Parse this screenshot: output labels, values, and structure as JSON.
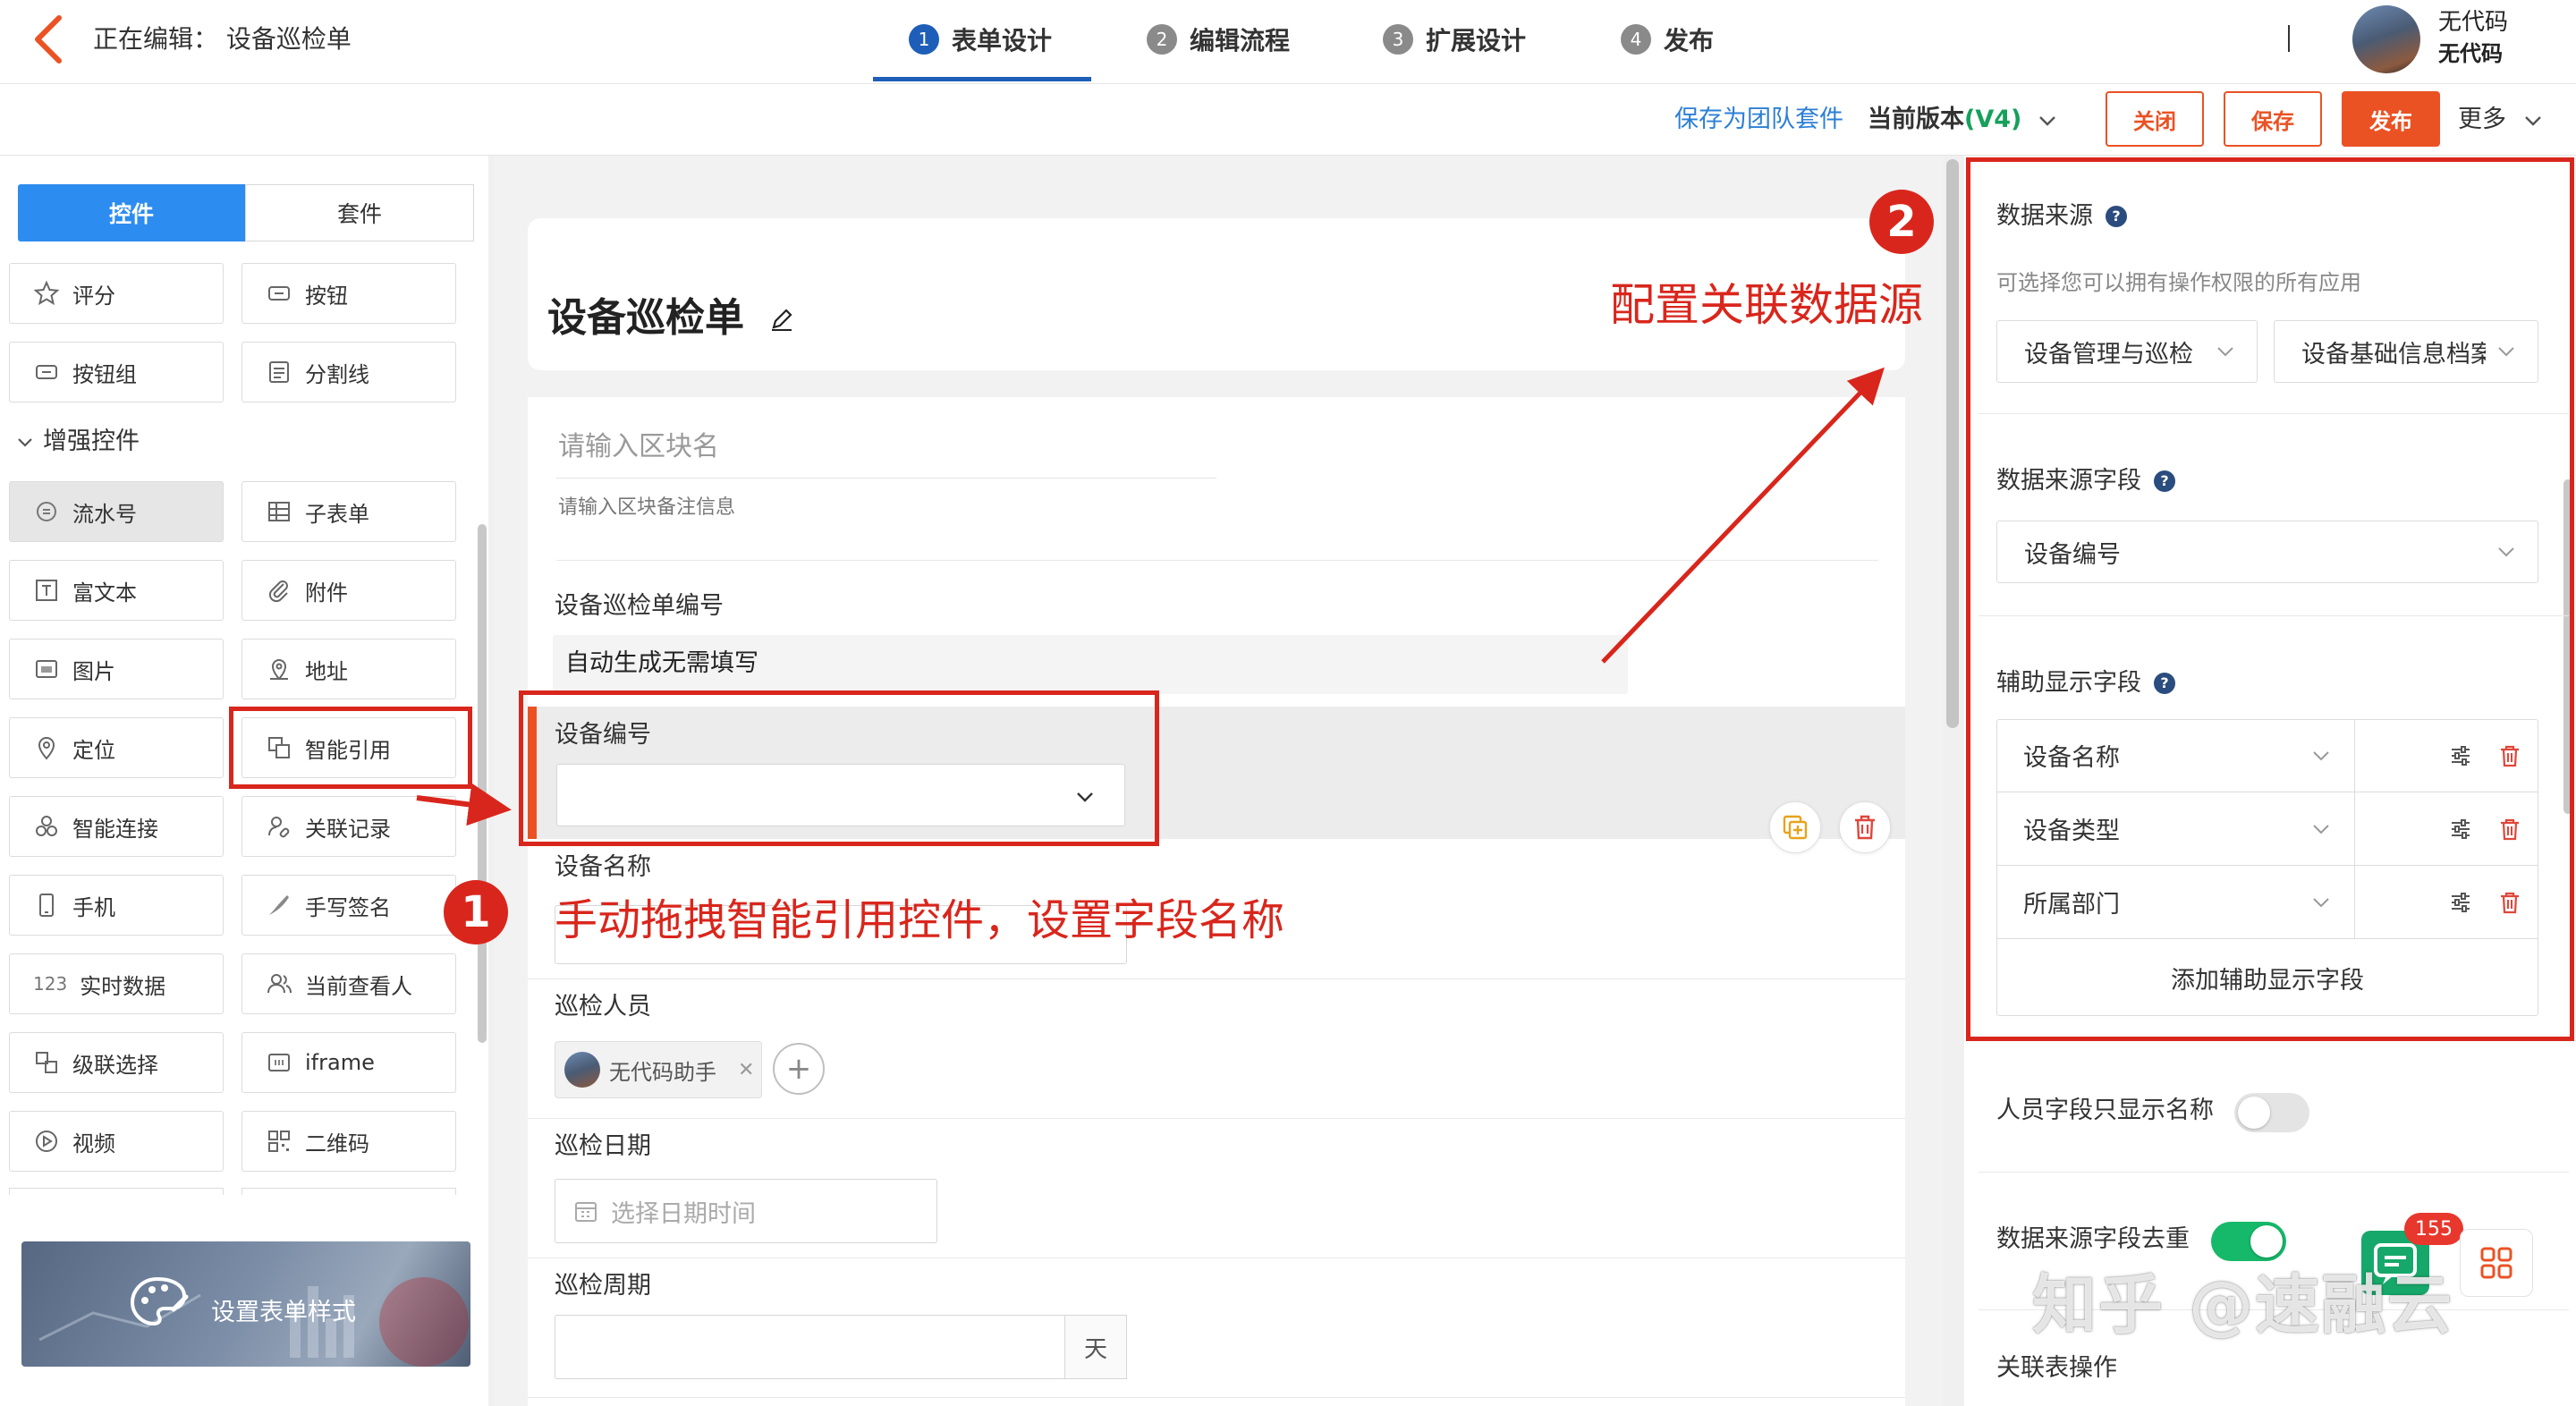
{
  "header": {
    "editing_label": "正在编辑：  设备巡检单",
    "steps": [
      {
        "num": "1",
        "label": "表单设计"
      },
      {
        "num": "2",
        "label": "编辑流程"
      },
      {
        "num": "3",
        "label": "扩展设计"
      },
      {
        "num": "4",
        "label": "发布"
      }
    ],
    "user_name": "无代码",
    "user_org": "无代码"
  },
  "actions": {
    "save_suite": "保存为团队套件",
    "version_prefix": "当前版本",
    "version_value": "(V4)",
    "close": "关闭",
    "save": "保存",
    "publish": "发布",
    "more": "更多"
  },
  "left": {
    "tab_controls": "控件",
    "tab_suites": "套件",
    "basic_controls": [
      {
        "icon": "star-icon",
        "label": "评分"
      },
      {
        "icon": "button-icon",
        "label": "按钮"
      },
      {
        "icon": "button-group-icon",
        "label": "按钮组"
      },
      {
        "icon": "divider-icon",
        "label": "分割线"
      }
    ],
    "enhanced_heading": "增强控件",
    "enhanced_controls": [
      {
        "icon": "serial-number-icon",
        "label": "流水号"
      },
      {
        "icon": "subform-icon",
        "label": "子表单"
      },
      {
        "icon": "rich-text-icon",
        "label": "富文本"
      },
      {
        "icon": "attachment-icon",
        "label": "附件"
      },
      {
        "icon": "image-icon",
        "label": "图片"
      },
      {
        "icon": "address-icon",
        "label": "地址"
      },
      {
        "icon": "location-icon",
        "label": "定位"
      },
      {
        "icon": "smart-reference-icon",
        "label": "智能引用"
      },
      {
        "icon": "smart-connect-icon",
        "label": "智能连接"
      },
      {
        "icon": "related-records-icon",
        "label": "关联记录"
      },
      {
        "icon": "phone-icon",
        "label": "手机"
      },
      {
        "icon": "signature-icon",
        "label": "手写签名"
      },
      {
        "icon": "realtime-data-icon",
        "label": "实时数据"
      },
      {
        "icon": "current-viewer-icon",
        "label": "当前查看人"
      },
      {
        "icon": "cascade-icon",
        "label": "级联选择"
      },
      {
        "icon": "iframe-icon",
        "label": "iframe"
      },
      {
        "icon": "video-icon",
        "label": "视频"
      },
      {
        "icon": "qrcode-icon",
        "label": "二维码"
      }
    ],
    "style_banner": "设置表单样式"
  },
  "form": {
    "title": "设备巡检单",
    "block_name_placeholder": "请输入区块名",
    "block_note_placeholder": "请输入区块备注信息",
    "field_inspection_no_label": "设备巡检单编号",
    "field_inspection_no_value": "自动生成无需填写",
    "field_device_no_label": "设备编号",
    "field_device_name_label": "设备名称",
    "field_inspector_label": "巡检人员",
    "inspector_chip": "无代码助手",
    "field_date_label": "巡检日期",
    "date_placeholder": "选择日期时间",
    "field_period_label": "巡检周期",
    "period_unit": "天"
  },
  "annotations": {
    "badge_1": "1",
    "badge_2": "2",
    "text_1": "手动拖拽智能引用控件，设置字段名称",
    "text_2": "配置关联数据源"
  },
  "right": {
    "data_source_label": "数据来源",
    "data_source_hint": "可选择您可以拥有操作权限的所有应用",
    "data_source_app": "设备管理与巡检",
    "data_source_form": "设备基础信息档案",
    "source_field_label": "数据来源字段",
    "source_field_value": "设备编号",
    "aux_label": "辅助显示字段",
    "aux_fields": [
      "设备名称",
      "设备类型",
      "所属部门"
    ],
    "add_aux": "添加辅助显示字段",
    "person_name_only_label": "人员字段只显示名称",
    "dedupe_label": "数据来源字段去重",
    "related_ops_label": "关联表操作",
    "notification_count": "155"
  },
  "watermark": "知乎 @速融云",
  "colors": {
    "accent_orange": "#ea5224",
    "primary_blue": "#2d8cf0",
    "step_blue": "#1e5eb8",
    "annotation_red": "#d9261c",
    "toggle_on_green": "#16b86a"
  }
}
